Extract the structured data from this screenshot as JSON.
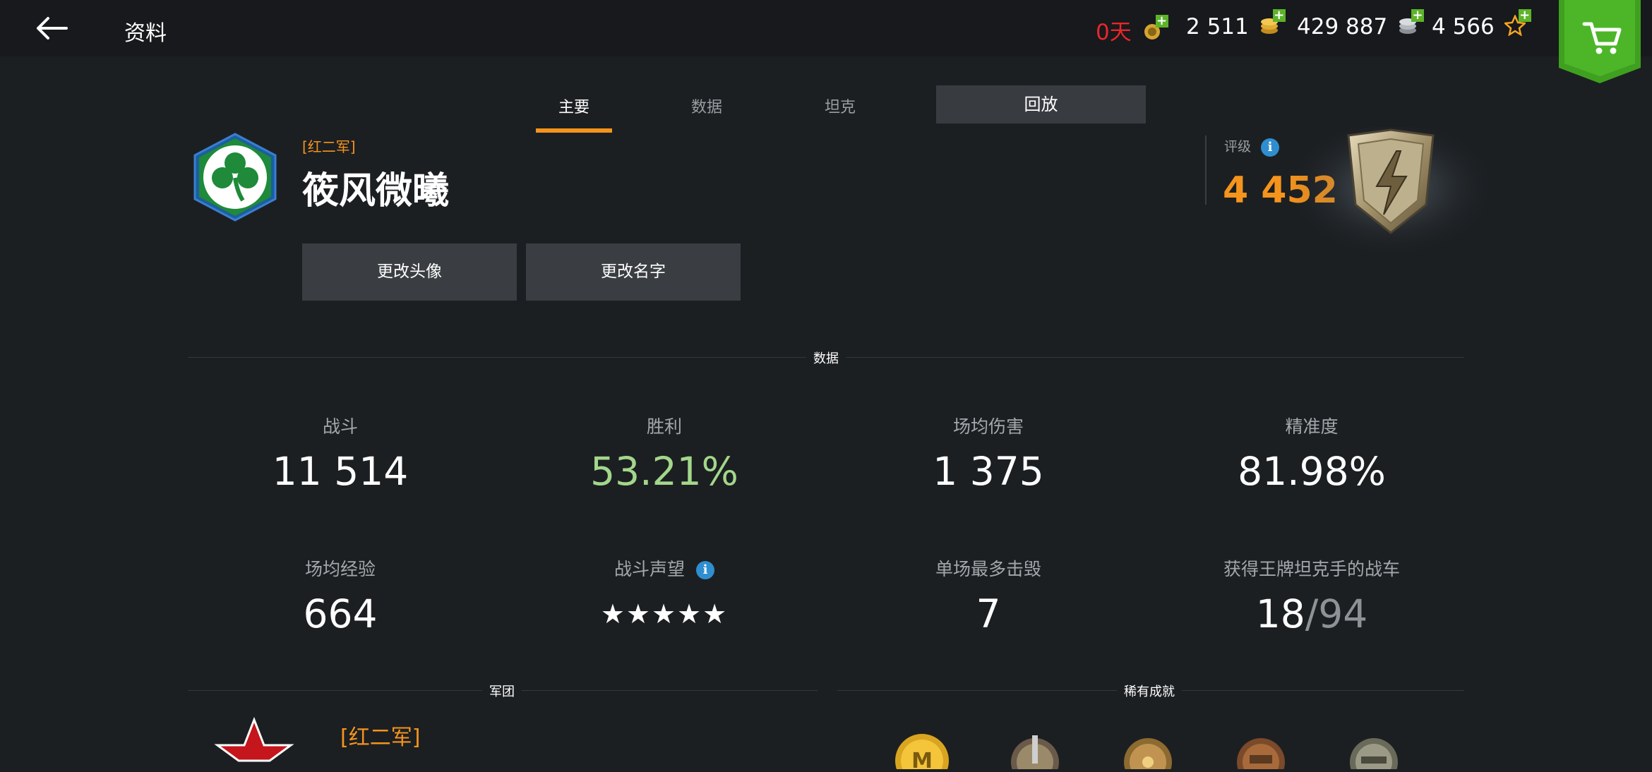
{
  "header": {
    "title": "资料",
    "premium_days": "0天",
    "gold": "2 511",
    "credits": "429 887",
    "free_xp": "4 566"
  },
  "tabs": [
    {
      "label": "主要",
      "active": true
    },
    {
      "label": "数据",
      "active": false
    },
    {
      "label": "坦克",
      "active": false
    }
  ],
  "replay_button": "回放",
  "profile": {
    "clan_tag": "[红二军]",
    "name": "筱风微曦",
    "change_avatar": "更改头像",
    "change_name": "更改名字"
  },
  "rating": {
    "label": "评级",
    "value": "4 452",
    "info_icon": "i"
  },
  "stats_section_label": "数据",
  "stats": {
    "battles": {
      "label": "战斗",
      "value": "11 514"
    },
    "wins": {
      "label": "胜利",
      "value": "53.21%"
    },
    "avg_damage": {
      "label": "场均伤害",
      "value": "1 375"
    },
    "accuracy": {
      "label": "精准度",
      "value": "81.98%"
    },
    "avg_xp": {
      "label": "场均经验",
      "value": "664"
    },
    "reputation": {
      "label": "战斗声望",
      "stars": "★★★★★",
      "rating_stars": 5
    },
    "max_kills": {
      "label": "单场最多击毁",
      "value": "7"
    },
    "mastery": {
      "label": "获得王牌坦克手的战车",
      "value": "18",
      "separator": "/",
      "total": "94"
    }
  },
  "clan_section": {
    "label": "军团",
    "clan_name": "[红二军]"
  },
  "achievements_section": {
    "label": "稀有成就"
  },
  "colors": {
    "accent_orange": "#f5941d",
    "win_green": "#a3d78b",
    "cart_green": "#3fa020",
    "background": "#1c1f22"
  }
}
